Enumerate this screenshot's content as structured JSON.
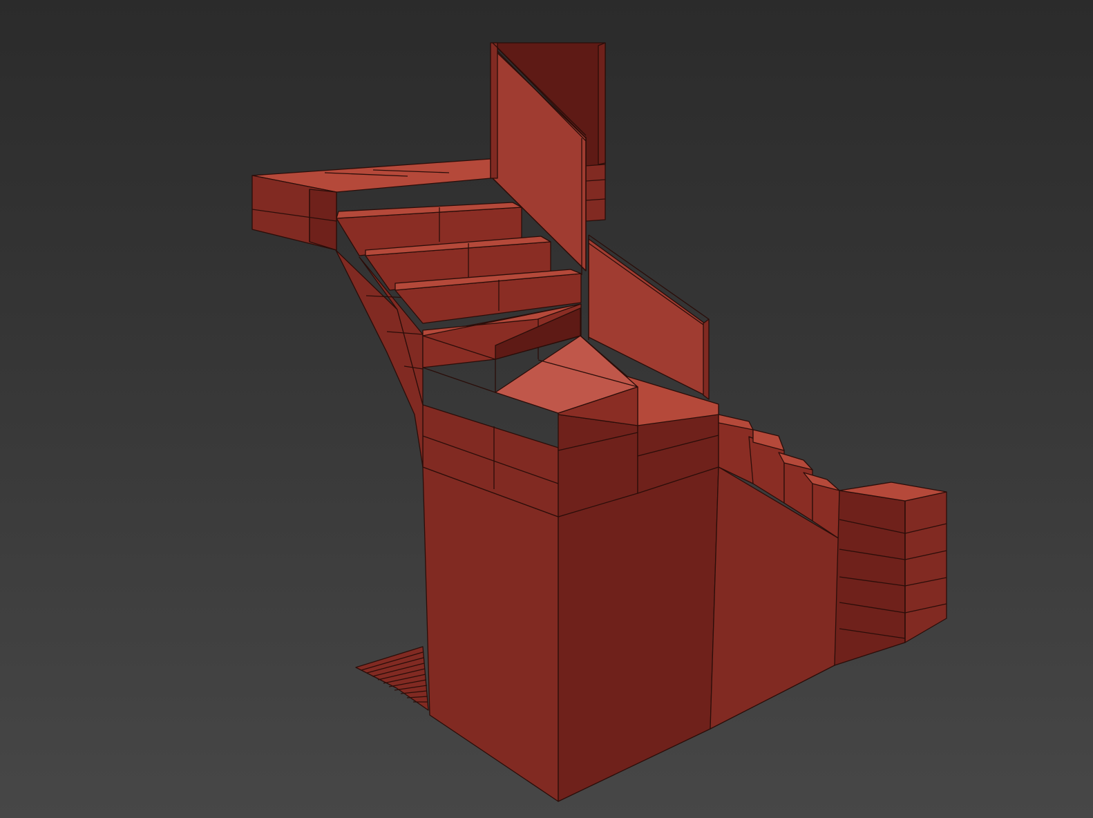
{
  "viewport": {
    "background_top": "#2b2b2b",
    "background_bottom": "#474747"
  },
  "model": {
    "object": "staircase",
    "colors": {
      "body": "#812a22",
      "tread": "#b5493a",
      "wireframe": "#2a0d09"
    }
  }
}
